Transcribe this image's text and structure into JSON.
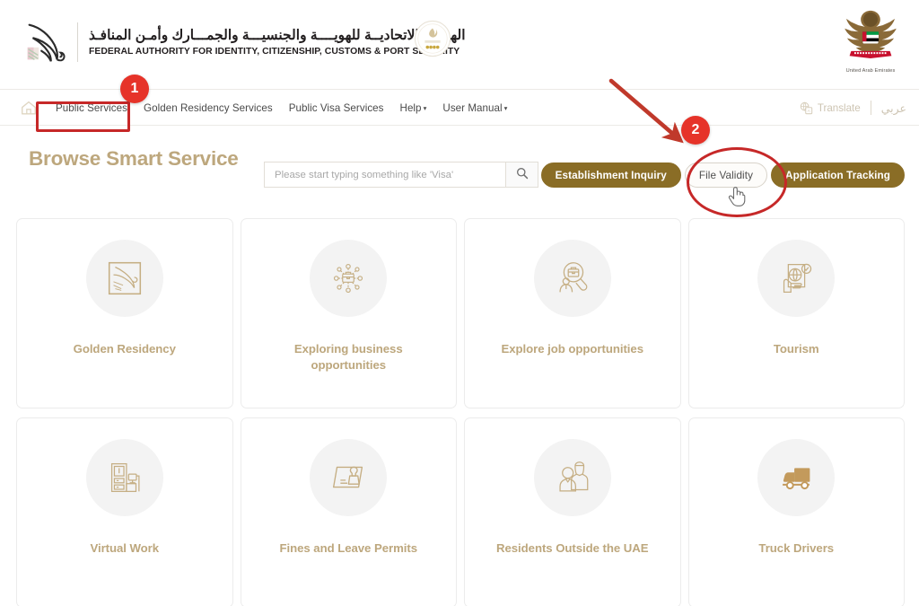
{
  "header": {
    "brand_arabic": "الهيئـــة الاتحاديــة للهويــــة والجنسيـــة والجمـــارك وأمـن المنافـذ",
    "brand_english": "FEDERAL AUTHORITY FOR IDENTITY, CITIZENSHIP, CUSTOMS & PORT SECURITY",
    "emblem_caption": "United Arab Emirates",
    "logo_icon": "falcon-logo-icon",
    "seal_icon": "government-seal-icon",
    "emblem_icon": "uae-emblem-icon"
  },
  "nav": {
    "home_icon": "home-icon",
    "items": [
      {
        "label": "Public Services",
        "has_caret": false
      },
      {
        "label": "Golden Residency Services",
        "has_caret": false
      },
      {
        "label": "Public Visa Services",
        "has_caret": false
      },
      {
        "label": "Help",
        "has_caret": true
      },
      {
        "label": "User Manual",
        "has_caret": true
      }
    ],
    "caret_glyph": "▾",
    "translate_label": "Translate",
    "translate_icon": "translate-icon",
    "arabic_label": "عربي"
  },
  "browse": {
    "title": "Browse Smart Service"
  },
  "search": {
    "value": "",
    "placeholder": "Please start typing something like 'Visa'",
    "button_icon": "search-icon"
  },
  "pills": [
    {
      "label": "Establishment Inquiry",
      "active": false
    },
    {
      "label": "File Validity",
      "active": true
    },
    {
      "label": "Application Tracking",
      "active": false
    }
  ],
  "cards": [
    {
      "label": "Golden Residency",
      "icon": "golden-residency-falcon-frame-icon"
    },
    {
      "label": "Exploring business opportunities",
      "icon": "business-network-briefcase-icon"
    },
    {
      "label": "Explore job opportunities",
      "icon": "job-search-person-icon"
    },
    {
      "label": "Tourism",
      "icon": "passport-globe-hand-icon"
    },
    {
      "label": "Virtual Work",
      "icon": "home-office-desk-icon"
    },
    {
      "label": "Fines and Leave Permits",
      "icon": "document-stamp-icon"
    },
    {
      "label": "Residents Outside the UAE",
      "icon": "two-people-icon"
    },
    {
      "label": "Truck Drivers",
      "icon": "delivery-truck-icon"
    }
  ],
  "annotations": {
    "badge_one": "1",
    "badge_two": "2",
    "accent_color": "#c62828",
    "badge_color": "#e63329",
    "arrow_icon": "pointer-arrow-icon",
    "cursor_icon": "hand-cursor-icon"
  },
  "colors": {
    "brand_gold": "#bda77d",
    "pill_olive": "#8a6d26",
    "text_dark": "#231f20"
  }
}
